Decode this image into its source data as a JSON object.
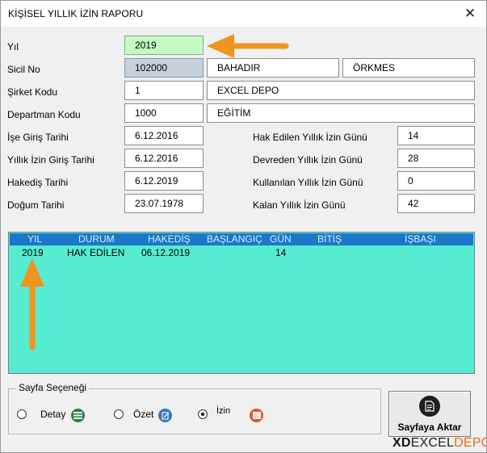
{
  "window": {
    "title": "KİŞİSEL YILLIK İZİN RAPORU",
    "close_glyph": "✕"
  },
  "fields": {
    "yil": {
      "label": "Yıl",
      "value": "2019"
    },
    "sicil": {
      "label": "Sicil No",
      "value": "102000",
      "first_name": "BAHADIR",
      "last_name": "ÖRKMES"
    },
    "sirket": {
      "label": "Şirket Kodu",
      "value": "1",
      "name": "EXCEL DEPO"
    },
    "departman": {
      "label": "Departman Kodu",
      "value": "1000",
      "name": "EĞİTİM"
    },
    "ise_giris": {
      "label": "İşe Giriş Tarihi",
      "value": "6.12.2016"
    },
    "yillik_izin_giris": {
      "label": "Yıllık İzin Giriş Tarihi",
      "value": "6.12.2016"
    },
    "hakedis": {
      "label": "Hakediş Tarihi",
      "value": "6.12.2019"
    },
    "dogum": {
      "label": "Doğum Tarihi",
      "value": "23.07.1978"
    },
    "hak_edilen": {
      "label": "Hak Edilen Yıllık İzin Günü",
      "value": "14"
    },
    "devreden": {
      "label": "Devreden Yıllık İzin Günü",
      "value": "28"
    },
    "kullanilan": {
      "label": "Kullanılan Yıllık İzin Günü",
      "value": "0"
    },
    "kalan": {
      "label": "Kalan Yıllık İzin Günü",
      "value": "42"
    }
  },
  "list": {
    "headers": [
      "YIL",
      "DURUM",
      "HAKEDİŞ",
      "BAŞLANGIÇ",
      "GÜN",
      "BİTİŞ",
      "İŞBAŞI"
    ],
    "rows": [
      {
        "yil": "2019",
        "durum": "HAK EDİLEN",
        "hakedis": "06.12.2019",
        "baslangic": "",
        "gun": "14",
        "bitis": "",
        "isbasi": ""
      }
    ],
    "bg_color": "#55ecd1",
    "header_color": "#1a77c9"
  },
  "page_options": {
    "caption": "Sayfa Seçeneği",
    "options": [
      {
        "label": "Detay",
        "checked": false,
        "icon": "list-icon",
        "color": "#2e7d4a"
      },
      {
        "label": "Özet",
        "checked": false,
        "icon": "edit-icon",
        "color": "#3a79b8"
      },
      {
        "label": "İzin",
        "checked": true,
        "icon": "calendar-icon",
        "color": "#e2542b"
      }
    ]
  },
  "export_button": {
    "label": "Sayfaya Aktar",
    "icon": "document-icon"
  },
  "logo": {
    "prefix": "XD",
    "part1": "EXCEL",
    "part2": "DEPO"
  },
  "accent_color": "#f0941e"
}
